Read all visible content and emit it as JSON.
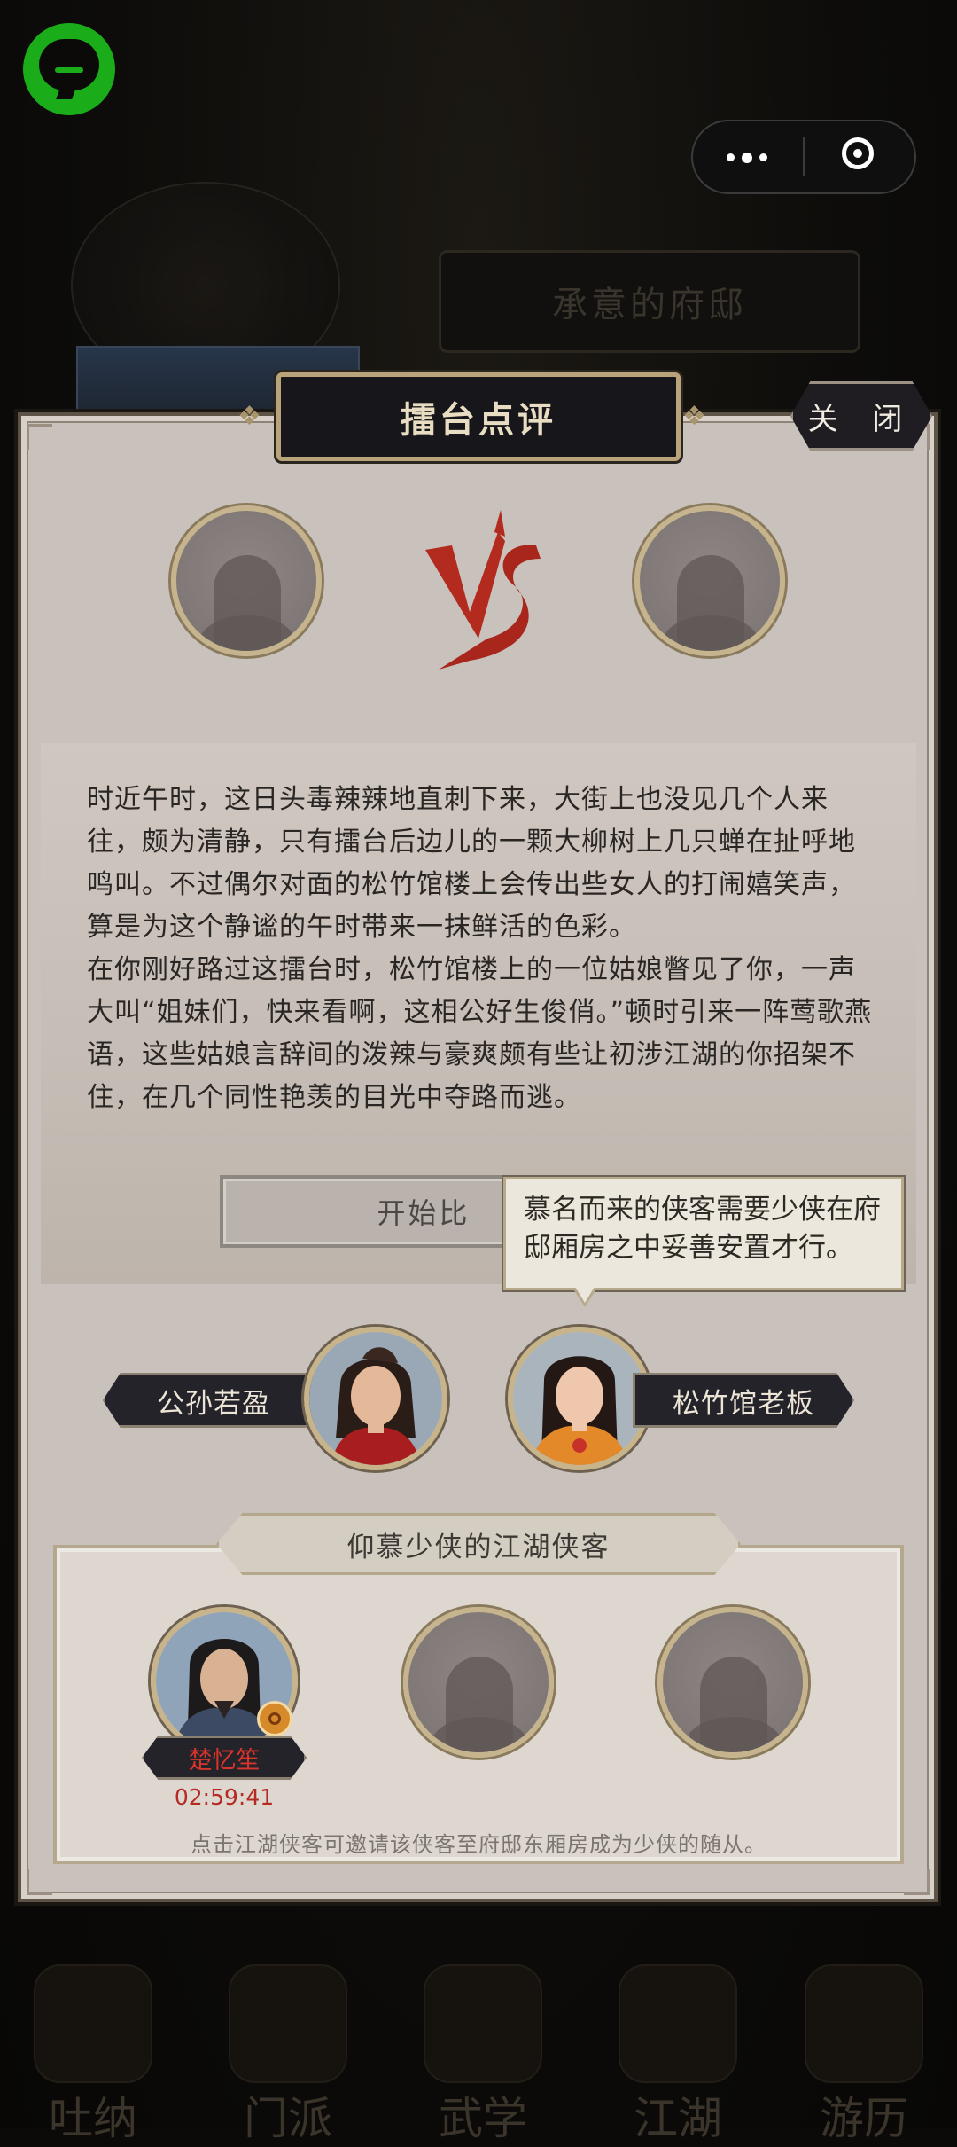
{
  "background": {
    "banner_title": "承意的府邸",
    "nav_items": [
      "吐纳",
      "门派",
      "武学",
      "江湖",
      "游历"
    ]
  },
  "dialog": {
    "title": "擂台点评",
    "close_label": "关 闭",
    "story_paragraphs": [
      "时近午时，这日头毒辣辣地直刺下来，大街上也没见几个人来往，颇为清静，只有擂台后边儿的一颗大柳树上几只蝉在扯呼地鸣叫。不过偶尔对面的松竹馆楼上会传出些女人的打闹嬉笑声，算是为这个静谧的午时带来一抹鲜活的色彩。",
      "在你刚好路过这擂台时，松竹馆楼上的一位姑娘瞥见了你，一声大叫“姐妹们，快来看啊，这相公好生俊俏。”顿时引来一阵莺歌燕语，这些姑娘言辞间的泼辣与豪爽颇有些让初涉江湖的你招架不住，在几个同性艳羡的目光中夺路而逃。"
    ],
    "start_button": "开始比",
    "tooltip": "慕名而来的侠客需要少侠在府邸厢房之中妥善安置才行。",
    "characters": {
      "left": "公孙若盈",
      "right": "松竹馆老板"
    },
    "guests": {
      "title": "仰慕少侠的江湖侠客",
      "guest_name": "楚忆笙",
      "timer": "02:59:41",
      "hint": "点击江湖侠客可邀请该侠客至府邸东厢房成为少侠的随从。"
    }
  }
}
